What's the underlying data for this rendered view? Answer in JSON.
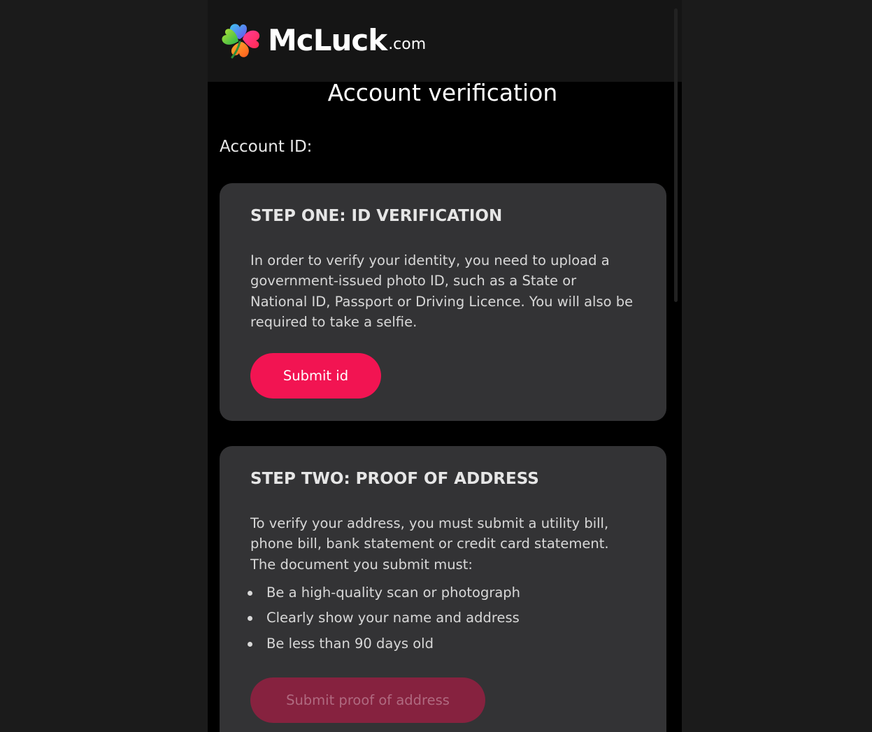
{
  "brand": {
    "name": "McLuck",
    "suffix": ".com",
    "colors": {
      "accent": "#f21452",
      "accent_disabled": "#86223f",
      "card_bg": "#333335",
      "page_bg": "#000000"
    }
  },
  "page": {
    "title": "Account verification",
    "account_id_label": "Account ID:"
  },
  "steps": [
    {
      "title": "STEP ONE: ID VERIFICATION",
      "description": "In order to verify your identity, you need to upload a government-issued photo ID, such as a State or National ID, Passport or Driving Licence. You will also be required to take a selfie.",
      "button_label": "Submit id",
      "button_enabled": true
    },
    {
      "title": "STEP TWO: PROOF OF ADDRESS",
      "description": "To verify your address, you must submit a utility bill, phone bill, bank statement or credit card statement. The document you submit must:",
      "requirements": [
        "Be a high-quality scan or photograph",
        "Clearly show your name and address",
        "Be less than 90 days old"
      ],
      "button_label": "Submit proof of address",
      "button_enabled": false
    }
  ],
  "icons": {
    "logo": "four-leaf-clover-icon",
    "bullet": "bullet-dot-icon"
  }
}
